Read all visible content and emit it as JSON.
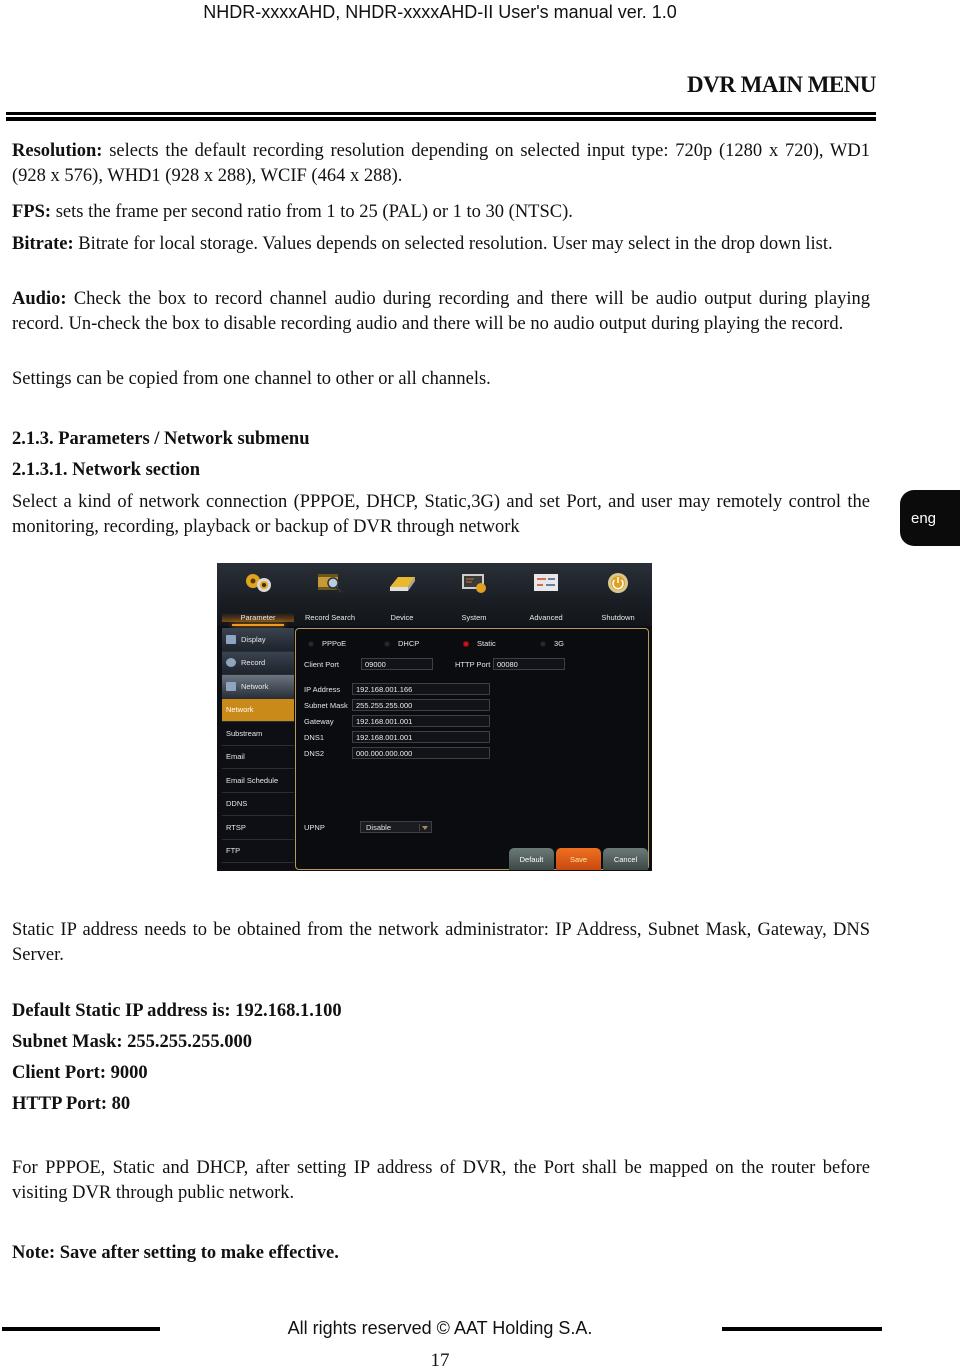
{
  "header": {
    "doc_title": "NHDR-xxxxAHD, NHDR-xxxxAHD-II User's manual ver. 1.0",
    "section_title": "DVR MAIN MENU"
  },
  "paragraphs": {
    "resolution_label": "Resolution:",
    "resolution_text": "selects the default recording resolution depending on selected input type: 720p (1280 x 720), WD1 (928 x 576), WHD1 (928 x 288), WCIF (464 x 288).",
    "fps_label": "FPS:",
    "fps_text": "sets the frame per second ratio from 1 to 25 (PAL) or 1 to 30 (NTSC).",
    "bitrate_label": "Bitrate:",
    "bitrate_text": "Bitrate for local storage. Values depends on selected resolution. User may select in the drop down list.",
    "audio_label": "Audio:",
    "audio_text": "Check the box to record channel audio during recording and there will be audio output during playing record. Un-check the box to disable recording audio and there will be no audio output during playing the record.",
    "copy_text": "Settings can be copied from one channel to other or all channels.",
    "heading_1": "2.1.3. Parameters / Network submenu",
    "heading_2": "2.1.3.1. Network section",
    "intro_text": "Select a kind of network connection (PPPOE, DHCP, Static,3G) and set Port, and user may remotely control the monitoring, recording, playback or backup of DVR through network",
    "static_ip_text": "Static IP address needs to be obtained from the network administrator: IP Address, Subnet Mask, Gateway, DNS Server.",
    "default_ip": "Default Static IP address is: 192.168.1.100",
    "default_mask": "Subnet Mask: 255.255.255.000",
    "default_client_port": "Client Port: 9000",
    "default_http_port": "HTTP Port: 80",
    "router_text": "For PPPOE, Static and DHCP, after setting IP address of DVR, the Port shall be mapped on the router before visiting DVR through public network.",
    "note_text": "Note: Save after setting to make effective."
  },
  "lang_tab": "eng",
  "dvr": {
    "top_tabs": [
      {
        "label": "Parameter",
        "icon": "gears-icon",
        "active": true
      },
      {
        "label": "Record Search",
        "icon": "film-search-icon"
      },
      {
        "label": "Device",
        "icon": "hard-drive-icon"
      },
      {
        "label": "System",
        "icon": "system-monitor-icon"
      },
      {
        "label": "Advanced",
        "icon": "advanced-sliders-icon"
      },
      {
        "label": "Shutdown",
        "icon": "power-icon"
      }
    ],
    "sidebar": [
      {
        "label": "Display",
        "type": "category"
      },
      {
        "label": "Record",
        "type": "category"
      },
      {
        "label": "Network",
        "type": "category-selected"
      },
      {
        "label": "Network",
        "type": "active"
      },
      {
        "label": "Substream"
      },
      {
        "label": "Email"
      },
      {
        "label": "Email Schedule"
      },
      {
        "label": "DDNS"
      },
      {
        "label": "RTSP"
      },
      {
        "label": "FTP"
      }
    ],
    "connection_types": [
      {
        "label": "PPPoE",
        "selected": false
      },
      {
        "label": "DHCP",
        "selected": false
      },
      {
        "label": "Static",
        "selected": true
      },
      {
        "label": "3G",
        "selected": false
      }
    ],
    "client_port_label": "Client Port",
    "client_port_value": "09000",
    "http_port_label": "HTTP Port",
    "http_port_value": "00080",
    "fields": [
      {
        "label": "IP Address",
        "value": "192.168.001.166"
      },
      {
        "label": "Subnet Mask",
        "value": "255.255.255.000"
      },
      {
        "label": "Gateway",
        "value": "192.168.001.001"
      },
      {
        "label": "DNS1",
        "value": "192.168.001.001"
      },
      {
        "label": "DNS2",
        "value": "000.000.000.000"
      }
    ],
    "upnp_label": "UPNP",
    "upnp_value": "Disable",
    "buttons": {
      "default": "Default",
      "save": "Save",
      "cancel": "Cancel"
    }
  },
  "footer": {
    "copyright": "All rights reserved © AAT Holding S.A.",
    "page_number": "17"
  }
}
